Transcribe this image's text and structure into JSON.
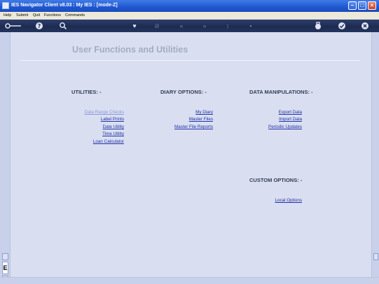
{
  "window": {
    "title": "IES Navigator Client v8.03 : My IES :      [mode-Z]",
    "controls": [
      "minimize",
      "maximize",
      "close"
    ]
  },
  "menu": [
    "Help",
    "Submit",
    "Quit",
    "Functions",
    "Commands"
  ],
  "toolbar": {
    "icons": [
      "key-icon",
      "help-icon",
      "search-icon",
      "heart-icon",
      "tag-icon",
      "rewind-icon",
      "fast-forward-icon",
      "cursor-icon",
      "stop-icon",
      "lock-icon",
      "check-icon",
      "close-icon"
    ]
  },
  "page": {
    "title": "User Functions and Utilities",
    "sections": {
      "utilities": {
        "heading": "UTILITIES: -",
        "items": [
          "Data Range Checks",
          "Label Prints",
          "Date Utility",
          "Time Utility",
          "Loan Calculator"
        ]
      },
      "diary": {
        "heading": "DIARY OPTIONS: -",
        "items": [
          "My Diary",
          "Master Files",
          "Master File Reports"
        ]
      },
      "data": {
        "heading": "DATA MANIPULATIONS: -",
        "items": [
          "Export Data",
          "Import Data",
          "Periodic Updates"
        ]
      },
      "custom": {
        "heading": "CUSTOM OPTIONS: -",
        "items": [
          "Local Options"
        ]
      }
    }
  },
  "side_strip": {
    "label": "E"
  }
}
